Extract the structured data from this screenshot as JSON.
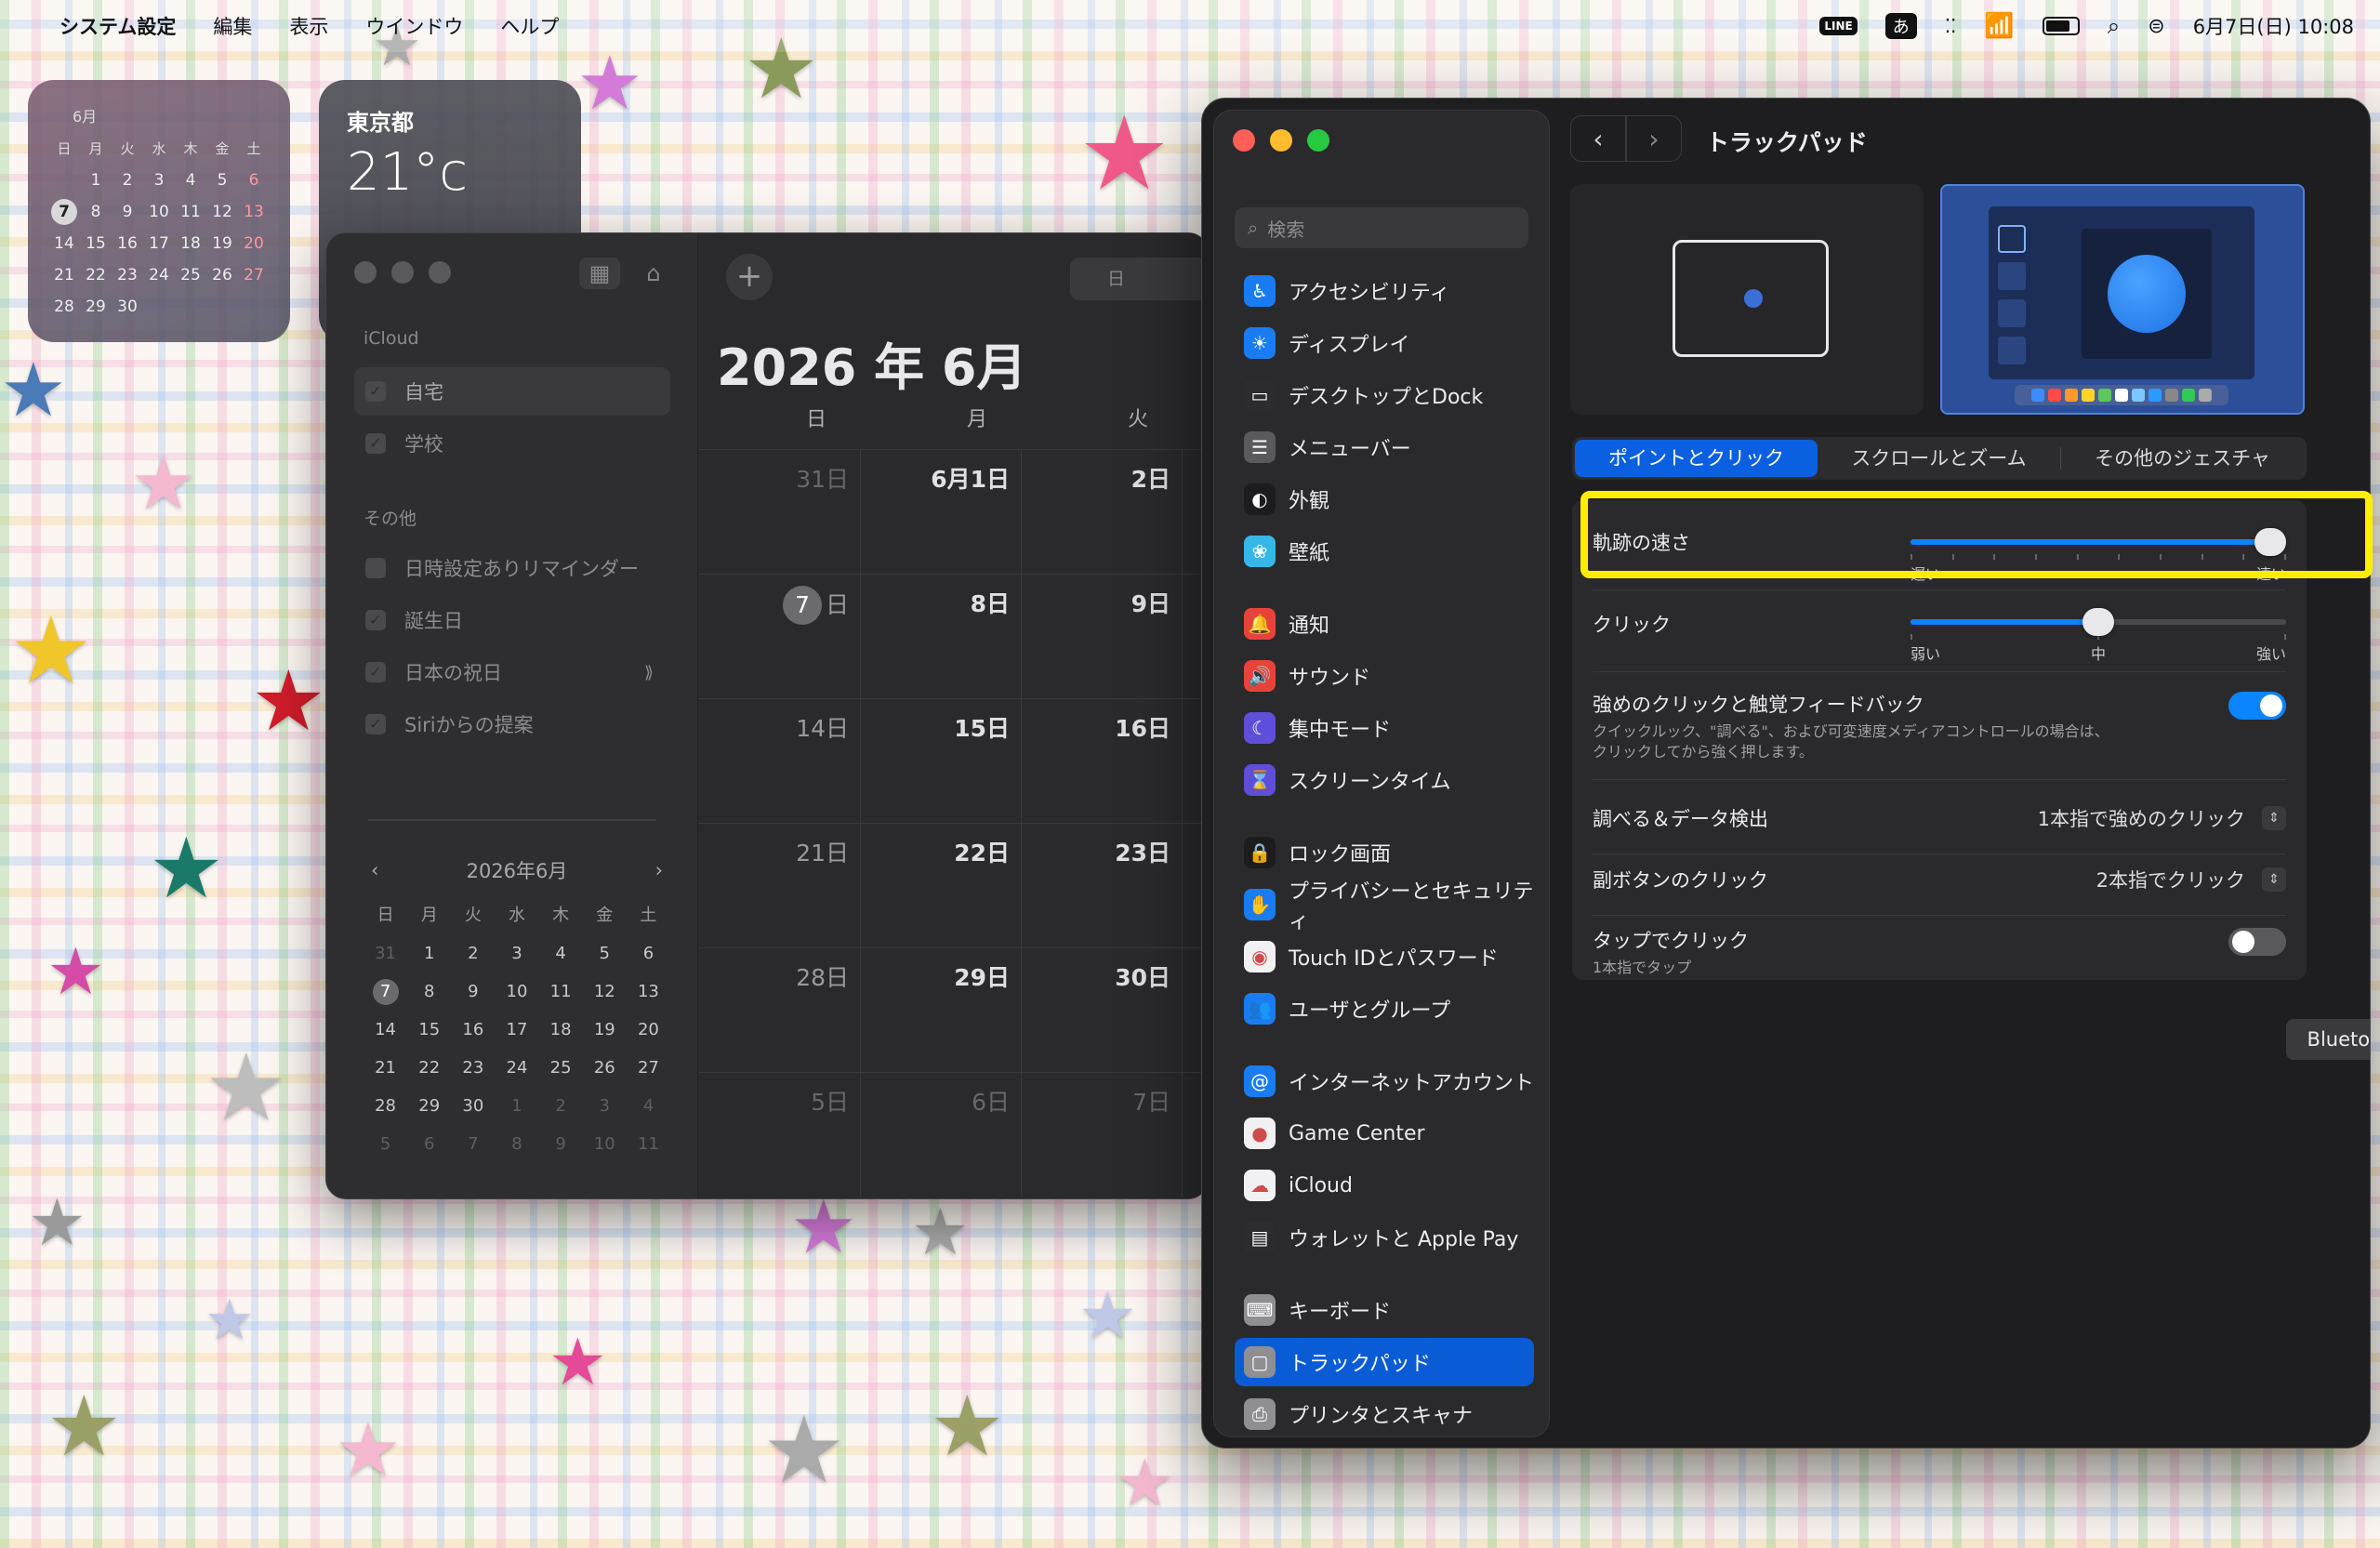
{
  "menubar": {
    "app": "システム設定",
    "items": [
      "編集",
      "表示",
      "ウインドウ",
      "ヘルプ"
    ],
    "line_badge": "LINE",
    "input_method": "あ",
    "datetime": "6月7日(日) 10:08"
  },
  "widget_calendar": {
    "month": "6月",
    "weekdays": [
      "日",
      "月",
      "火",
      "水",
      "木",
      "金",
      "土"
    ],
    "days": [
      "",
      "1",
      "2",
      "3",
      "4",
      "5",
      "6",
      "7",
      "8",
      "9",
      "10",
      "11",
      "12",
      "13",
      "14",
      "15",
      "16",
      "17",
      "18",
      "19",
      "20",
      "21",
      "22",
      "23",
      "24",
      "25",
      "26",
      "27",
      "28",
      "29",
      "30"
    ],
    "today": "7"
  },
  "widget_weather": {
    "city": "東京都",
    "temp": "21°c"
  },
  "calendar": {
    "section_icloud": "iCloud",
    "icloud_items": [
      "自宅",
      "学校"
    ],
    "section_other": "その他",
    "other_items": [
      "日時設定ありリマインダー",
      "誕生日",
      "日本の祝日",
      "Siriからの提案"
    ],
    "mini_title": "2026年6月",
    "mini_weekdays": [
      "日",
      "月",
      "火",
      "水",
      "木",
      "金",
      "土"
    ],
    "mini_days": [
      [
        "31",
        "1",
        "2",
        "3",
        "4",
        "5",
        "6"
      ],
      [
        "7",
        "8",
        "9",
        "10",
        "11",
        "12",
        "13"
      ],
      [
        "14",
        "15",
        "16",
        "17",
        "18",
        "19",
        "20"
      ],
      [
        "21",
        "22",
        "23",
        "24",
        "25",
        "26",
        "27"
      ],
      [
        "28",
        "29",
        "30",
        "1",
        "2",
        "3",
        "4"
      ],
      [
        "5",
        "6",
        "7",
        "8",
        "9",
        "10",
        "11"
      ]
    ],
    "view_label": "日",
    "month_title": "2026 年 6月",
    "week_headers": [
      "日",
      "月",
      "火"
    ],
    "weeks": [
      [
        "31日",
        "6月1日",
        "2日"
      ],
      [
        "日",
        "8日",
        "9日"
      ],
      [
        "14日",
        "15日",
        "16日"
      ],
      [
        "21日",
        "22日",
        "23日"
      ],
      [
        "28日",
        "29日",
        "30日"
      ],
      [
        "5日",
        "6日",
        "7日"
      ]
    ],
    "today_number": "7"
  },
  "settings": {
    "search_placeholder": "検索",
    "sidebar": [
      {
        "label": "アクセシビリティ",
        "icon": "accessibility-icon",
        "color": "#1a7cf2",
        "glyph": "♿"
      },
      {
        "label": "ディスプレイ",
        "icon": "display-icon",
        "color": "#1a7cf2",
        "glyph": "☀"
      },
      {
        "label": "デスクトップとDock",
        "icon": "dock-icon",
        "color": "#2c2c2e",
        "glyph": "▭"
      },
      {
        "label": "メニューバー",
        "icon": "menubar-icon",
        "color": "#5a5a5e",
        "glyph": "☰"
      },
      {
        "label": "外観",
        "icon": "appearance-icon",
        "color": "#1c1c1e",
        "glyph": "◐"
      },
      {
        "label": "壁紙",
        "icon": "wallpaper-icon",
        "color": "#35b8e8",
        "glyph": "❀"
      },
      {
        "label": "通知",
        "icon": "notification-icon",
        "color": "#e8433a",
        "glyph": "🔔"
      },
      {
        "label": "サウンド",
        "icon": "sound-icon",
        "color": "#e8433a",
        "glyph": "🔊"
      },
      {
        "label": "集中モード",
        "icon": "focus-icon",
        "color": "#5e4ed8",
        "glyph": "☾"
      },
      {
        "label": "スクリーンタイム",
        "icon": "screentime-icon",
        "color": "#5e4ed8",
        "glyph": "⌛"
      },
      {
        "label": "ロック画面",
        "icon": "lock-icon",
        "color": "#1c1c1e",
        "glyph": "🔒"
      },
      {
        "label": "プライバシーとセキュリティ",
        "icon": "privacy-hand-icon",
        "color": "#1a7cf2",
        "glyph": "✋"
      },
      {
        "label": "Touch IDとパスワード",
        "icon": "fingerprint-icon",
        "color": "#f1f1f3",
        "glyph": "◉"
      },
      {
        "label": "ユーザとグループ",
        "icon": "users-icon",
        "color": "#1a7cf2",
        "glyph": "👥"
      },
      {
        "label": "インターネットアカウント",
        "icon": "at-icon",
        "color": "#1a7cf2",
        "glyph": "@"
      },
      {
        "label": "Game Center",
        "icon": "gamecenter-icon",
        "color": "#f1f1f3",
        "glyph": "●"
      },
      {
        "label": "iCloud",
        "icon": "icloud-icon",
        "color": "#f1f1f3",
        "glyph": "☁"
      },
      {
        "label": "ウォレットと Apple Pay",
        "icon": "wallet-icon",
        "color": "#2c2c2e",
        "glyph": "▤"
      },
      {
        "label": "キーボード",
        "icon": "keyboard-icon",
        "color": "#8e8e93",
        "glyph": "⌨"
      },
      {
        "label": "トラックパッド",
        "icon": "trackpad-icon",
        "color": "#8e8e93",
        "glyph": "▢"
      },
      {
        "label": "プリンタとスキャナ",
        "icon": "printer-icon",
        "color": "#8e8e93",
        "glyph": "⎙"
      }
    ],
    "title": "トラックパッド",
    "tabs": [
      "ポイントとクリック",
      "スクロールとズーム",
      "その他のジェスチャ"
    ],
    "tracking": {
      "label": "軌跡の速さ",
      "min_label": "遅い",
      "max_label": "速い",
      "value": 1.0
    },
    "click": {
      "label": "クリック",
      "labels": [
        "弱い",
        "中",
        "強い"
      ],
      "value": 0.5
    },
    "force_click": {
      "label": "強めのクリックと触覚フィードバック",
      "desc1": "クイックルック、\"調べる\"、および可変速度メディアコントロールの場合は、",
      "desc2": "クリックしてから強く押します。",
      "on": true
    },
    "lookup": {
      "label": "調べる＆データ検出",
      "value": "1本指で強めのクリック"
    },
    "secondary": {
      "label": "副ボタンのクリック",
      "value": "2本指でクリック"
    },
    "tap": {
      "label": "タップでクリック",
      "sub": "1本指でタップ",
      "on": false
    },
    "bt_button": "Bluetoothトラックパッドを設定...",
    "help": "?"
  }
}
